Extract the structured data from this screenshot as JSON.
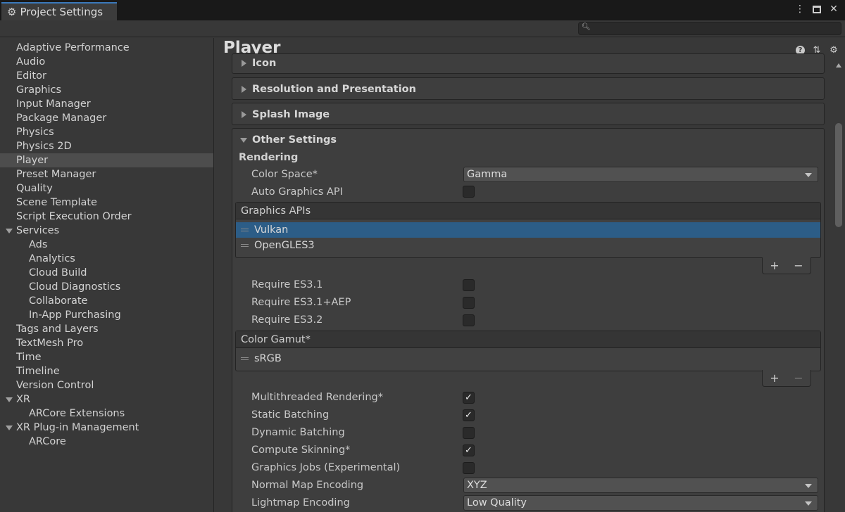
{
  "window": {
    "tab_title": "Project Settings",
    "icons": [
      "gear-icon",
      "kebab-menu-icon",
      "maximize-icon",
      "close-icon"
    ]
  },
  "search": {
    "value": "",
    "placeholder": ""
  },
  "sidebar": {
    "items": [
      {
        "label": "Adaptive Performance"
      },
      {
        "label": "Audio"
      },
      {
        "label": "Editor"
      },
      {
        "label": "Graphics"
      },
      {
        "label": "Input Manager"
      },
      {
        "label": "Package Manager"
      },
      {
        "label": "Physics"
      },
      {
        "label": "Physics 2D"
      },
      {
        "label": "Player",
        "selected": true
      },
      {
        "label": "Preset Manager"
      },
      {
        "label": "Quality"
      },
      {
        "label": "Scene Template"
      },
      {
        "label": "Script Execution Order"
      },
      {
        "label": "Services",
        "expanded": true
      },
      {
        "label": "Ads",
        "child": true
      },
      {
        "label": "Analytics",
        "child": true
      },
      {
        "label": "Cloud Build",
        "child": true
      },
      {
        "label": "Cloud Diagnostics",
        "child": true
      },
      {
        "label": "Collaborate",
        "child": true
      },
      {
        "label": "In-App Purchasing",
        "child": true
      },
      {
        "label": "Tags and Layers"
      },
      {
        "label": "TextMesh Pro"
      },
      {
        "label": "Time"
      },
      {
        "label": "Timeline"
      },
      {
        "label": "Version Control"
      },
      {
        "label": "XR",
        "expanded": true
      },
      {
        "label": "ARCore Extensions",
        "child": true
      },
      {
        "label": "XR Plug-in Management",
        "expanded": true
      },
      {
        "label": "ARCore",
        "child": true
      }
    ]
  },
  "main": {
    "title": "Player",
    "header_icons": [
      "help-icon",
      "preset-sliders-icon",
      "settings-gear-icon"
    ],
    "foldouts": {
      "icon": "Icon",
      "resolution": "Resolution and Presentation",
      "splash": "Splash Image",
      "other": "Other Settings"
    },
    "rendering": {
      "section": "Rendering",
      "color_space_label": "Color Space*",
      "color_space_value": "Gamma",
      "auto_graphics_label": "Auto Graphics API",
      "auto_graphics_checked": false,
      "graphics_apis": {
        "header": "Graphics APIs",
        "items": [
          "Vulkan",
          "OpenGLES3"
        ],
        "selected_index": 0
      },
      "require_es31_label": "Require ES3.1",
      "require_es31aep_label": "Require ES3.1+AEP",
      "require_es32_label": "Require ES3.2",
      "color_gamut": {
        "header": "Color Gamut*",
        "items": [
          "sRGB"
        ]
      },
      "multithreaded_label": "Multithreaded Rendering*",
      "static_batching_label": "Static Batching",
      "dynamic_batching_label": "Dynamic Batching",
      "compute_skinning_label": "Compute Skinning*",
      "graphics_jobs_label": "Graphics Jobs (Experimental)",
      "normal_map_label": "Normal Map Encoding",
      "normal_map_value": "XYZ",
      "lightmap_label": "Lightmap Encoding",
      "lightmap_value": "Low Quality",
      "checked_glyph": "✓",
      "add_glyph": "+",
      "remove_glyph": "−"
    }
  }
}
